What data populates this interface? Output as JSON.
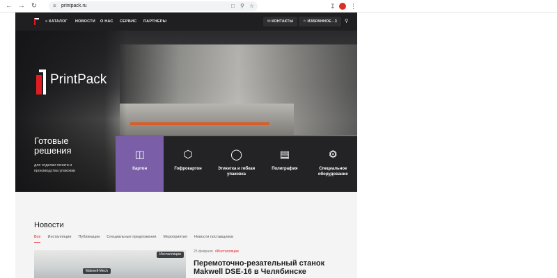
{
  "browser": {
    "back_icon": "arrow-left-icon",
    "forward_icon": "arrow-right-icon",
    "reload_icon": "reload-icon",
    "url": "printpack.ru"
  },
  "site": {
    "topbar": {
      "menu": [
        "КАТАЛОГ",
        "НОВОСТИ",
        "О НАС",
        "СЕРВИС",
        "ПАРТНЕРЫ"
      ],
      "contacts_label": "КОНТАКТЫ",
      "favorites_label": "ИЗБРАННОЕ - 3"
    },
    "brand": "PrintPack",
    "hero": {
      "title_line1": "Готовые",
      "title_line2": "решения",
      "subtitle_line1": "для отделки печати и",
      "subtitle_line2": "производства упаковки"
    },
    "categories": [
      {
        "label": "Картон",
        "icon": "box-icon",
        "active": true
      },
      {
        "label": "Гофрокартон",
        "icon": "cube-icon",
        "active": false
      },
      {
        "label": "Этикетка и гибкая упаковка",
        "icon": "label-icon",
        "active": false
      },
      {
        "label": "Полиграфия",
        "icon": "book-icon",
        "active": false
      },
      {
        "label": "Специальное оборудование",
        "icon": "gears-icon",
        "active": false
      }
    ],
    "news": {
      "title": "Новости",
      "tabs": [
        "Все",
        "Инсталляции",
        "Публикации",
        "Специальные предложения",
        "Мероприятия",
        "Новости поставщиков"
      ],
      "active_tab": "Все",
      "card": {
        "badge": "Инсталляции",
        "image_label": "Makwell-Mech",
        "date": "25 февраля",
        "tag": "#Инсталляции",
        "headline": "Перемоточно-резательный станок Makwell DSE-16 в Челябинске"
      }
    }
  }
}
